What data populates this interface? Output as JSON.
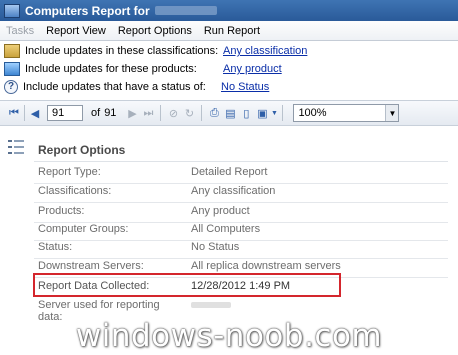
{
  "window": {
    "title": "Computers Report for"
  },
  "menu": {
    "items": [
      "Tasks",
      "Report View",
      "Report Options",
      "Run Report"
    ]
  },
  "filters": [
    {
      "label": "Include updates in these classifications:",
      "value": "Any classification"
    },
    {
      "label": "Include updates for these products:",
      "value": "Any product"
    },
    {
      "label": "Include updates that have a status of:",
      "value": "No Status"
    }
  ],
  "toolbar": {
    "current_page": "91",
    "of_label": "of",
    "total_pages": "91",
    "zoom": "100%"
  },
  "report": {
    "section_title": "Report Options",
    "rows": [
      {
        "key": "Report Type:",
        "value": "Detailed Report"
      },
      {
        "key": "Classifications:",
        "value": "Any classification"
      },
      {
        "key": "Products:",
        "value": "Any product"
      },
      {
        "key": "Computer Groups:",
        "value": "All Computers"
      },
      {
        "key": "Status:",
        "value": "No Status"
      },
      {
        "key": "Downstream Servers:",
        "value": "All replica downstream servers"
      },
      {
        "key": "Report Data Collected:",
        "value": "12/28/2012 1:49 PM"
      },
      {
        "key": "Server used for reporting data:",
        "value": ""
      }
    ]
  },
  "watermark": "windows-noob.com",
  "colors": {
    "title_bar": "#2a5a99",
    "link": "#0a2ea8",
    "highlight_border": "#d4262d"
  }
}
